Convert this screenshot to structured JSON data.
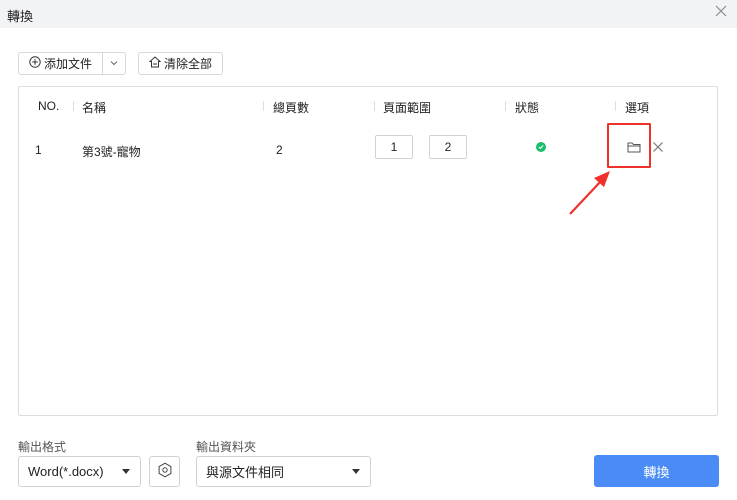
{
  "window": {
    "title": "轉換"
  },
  "toolbar": {
    "add_file_label": "添加文件",
    "clear_all_label": "清除全部"
  },
  "table": {
    "headers": [
      "NO.",
      "名稱",
      "總頁數",
      "頁面範圍",
      "狀態",
      "選項"
    ],
    "rows": [
      {
        "no": "1",
        "name": "第3號-寵物",
        "pages": "2",
        "range_from": "1",
        "range_to": "2",
        "status": "success"
      }
    ]
  },
  "output": {
    "format_label": "輸出格式",
    "format_value": "Word(*.docx)",
    "folder_label": "輸出資料夾",
    "folder_value": "與源文件相同"
  },
  "convert_label": "轉換",
  "colors": {
    "accent": "#4b8bf5",
    "status_ok": "#19be6b",
    "highlight": "#f0312b"
  },
  "icons": [
    "close-icon",
    "add-circle-icon",
    "chevron-down-icon",
    "clear-icon",
    "check-icon",
    "folder-icon",
    "remove-icon",
    "settings-hex-icon",
    "arrow-icon"
  ]
}
